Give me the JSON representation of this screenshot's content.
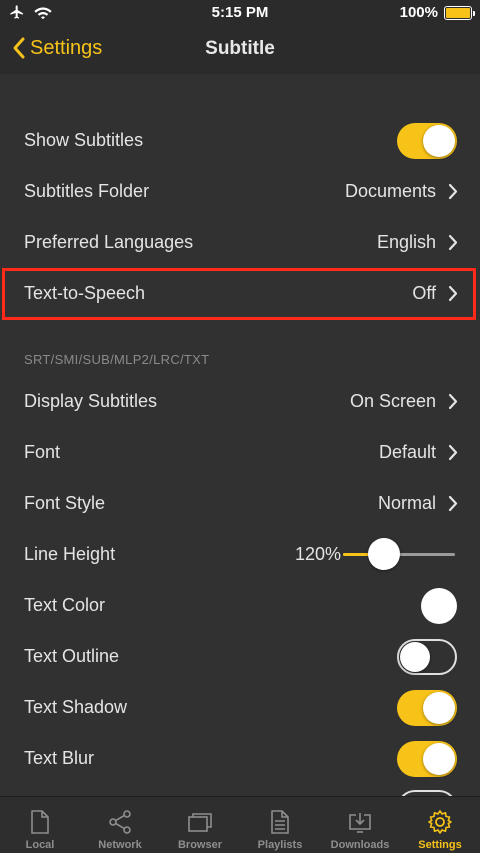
{
  "status_bar": {
    "time": "5:15 PM",
    "battery": "100%",
    "battery_level": 1.0
  },
  "nav": {
    "back_label": "Settings",
    "title": "Subtitle"
  },
  "rows": {
    "show_subtitles": {
      "label": "Show Subtitles",
      "on": true
    },
    "subtitles_folder": {
      "label": "Subtitles Folder",
      "value": "Documents"
    },
    "preferred_languages": {
      "label": "Preferred Languages",
      "value": "English"
    },
    "text_to_speech": {
      "label": "Text-to-Speech",
      "value": "Off"
    }
  },
  "section": {
    "header": "SRT/SMI/SUB/MLP2/LRC/TXT"
  },
  "display_rows": {
    "display_subtitles": {
      "label": "Display Subtitles",
      "value": "On Screen"
    },
    "font": {
      "label": "Font",
      "value": "Default"
    },
    "font_style": {
      "label": "Font Style",
      "value": "Normal"
    },
    "line_height": {
      "label": "Line Height",
      "value": "120%",
      "level": 0.37
    },
    "text_color": {
      "label": "Text Color",
      "color": "#ffffff"
    },
    "text_outline": {
      "label": "Text Outline",
      "on": false
    },
    "text_shadow": {
      "label": "Text Shadow",
      "on": true
    },
    "text_blur": {
      "label": "Text Blur",
      "on": true
    }
  },
  "tabs": [
    {
      "label": "Local",
      "icon": "document-icon",
      "active": false
    },
    {
      "label": "Network",
      "icon": "share-icon",
      "active": false
    },
    {
      "label": "Browser",
      "icon": "browser-icon",
      "active": false
    },
    {
      "label": "Playlists",
      "icon": "playlist-icon",
      "active": false
    },
    {
      "label": "Downloads",
      "icon": "download-icon",
      "active": false
    },
    {
      "label": "Settings",
      "icon": "gear-icon",
      "active": true
    }
  ],
  "colors": {
    "accent": "#f7c318",
    "highlight": "#ff2a1a",
    "background": "#313131"
  }
}
